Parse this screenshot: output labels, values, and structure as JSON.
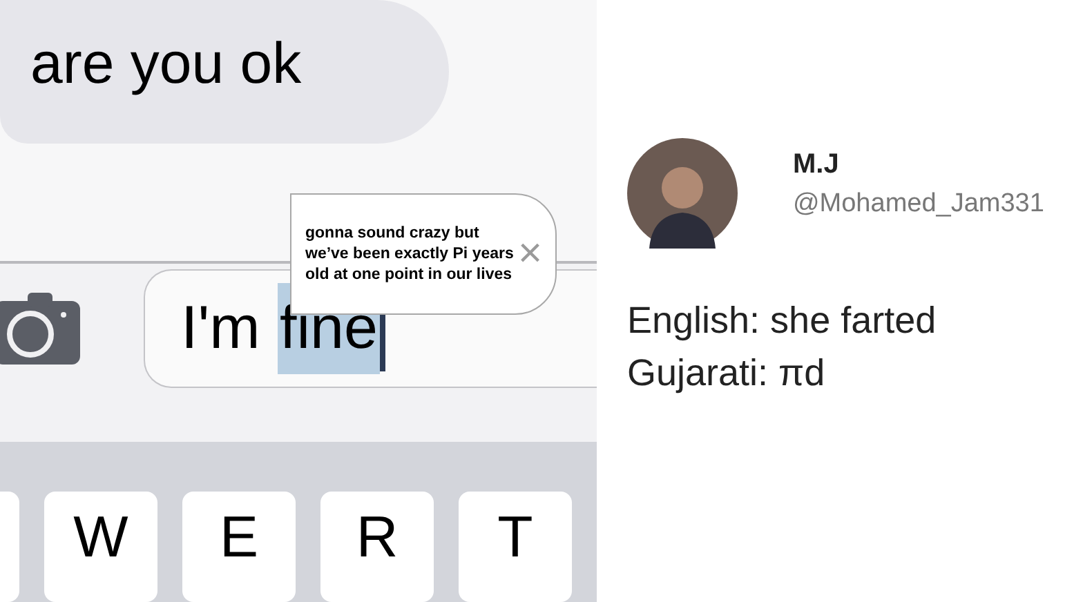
{
  "chat": {
    "message": "are you ok"
  },
  "suggestion": {
    "text": "gonna sound crazy but we’ve been exactly Pi years old at one point in our lives",
    "close": "×"
  },
  "input": {
    "value": "I'm ",
    "selection": "fine"
  },
  "keyboard": {
    "keys": [
      "W",
      "E",
      "R",
      "T"
    ]
  },
  "tweet": {
    "name": "M.J",
    "handle": "@Mohamed_Jam331",
    "lines": [
      "English: she farted",
      "Gujarati: πd"
    ]
  }
}
